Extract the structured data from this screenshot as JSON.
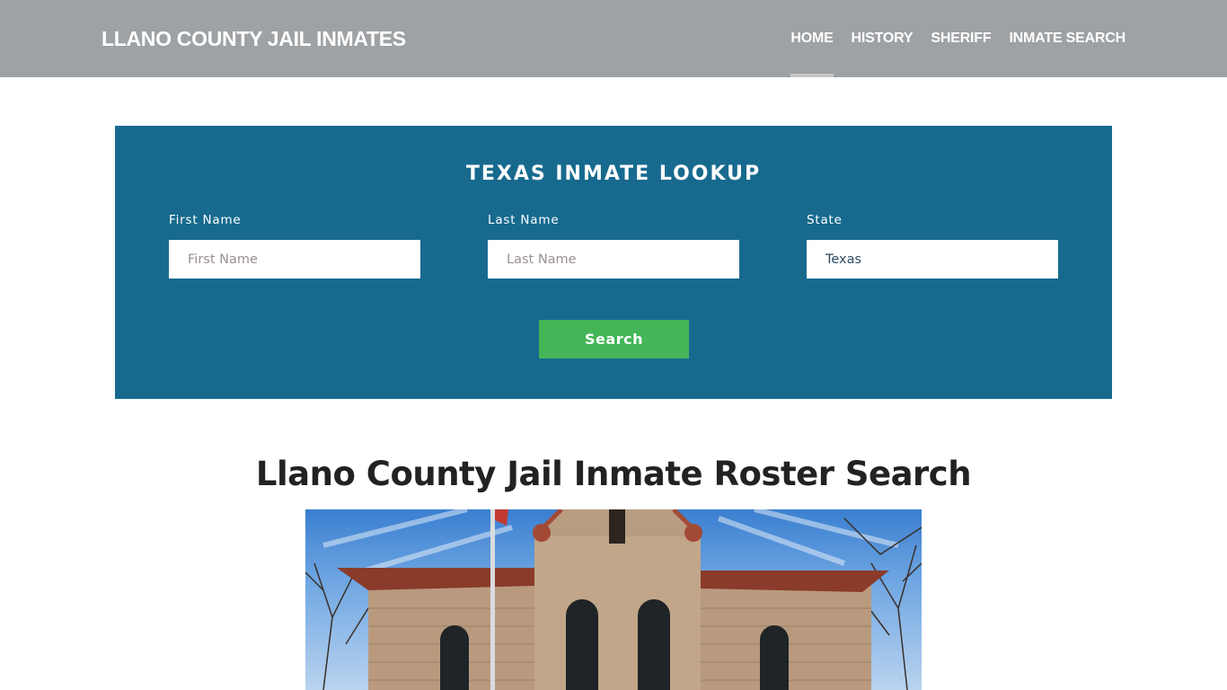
{
  "header": {
    "brand": "LLANO COUNTY JAIL INMATES",
    "nav": [
      {
        "label": "HOME",
        "active": true
      },
      {
        "label": "HISTORY",
        "active": false
      },
      {
        "label": "SHERIFF",
        "active": false
      },
      {
        "label": "INMATE SEARCH",
        "active": false
      }
    ]
  },
  "lookup": {
    "title": "TEXAS INMATE LOOKUP",
    "first_name": {
      "label": "First Name",
      "placeholder": "First Name",
      "value": ""
    },
    "last_name": {
      "label": "Last Name",
      "placeholder": "Last Name",
      "value": ""
    },
    "state": {
      "label": "State",
      "value": "Texas"
    },
    "search_label": "Search"
  },
  "main": {
    "heading": "Llano County Jail Inmate Roster Search",
    "image_alt": "Llano County Jail building"
  },
  "colors": {
    "navbar": "#9fa2a5",
    "lookup_panel": "#176a8e",
    "search_button": "#44b657"
  }
}
